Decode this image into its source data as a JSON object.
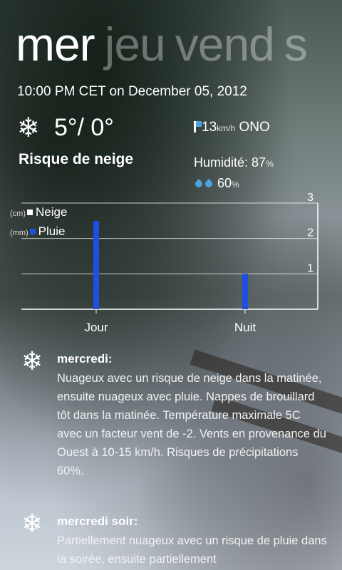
{
  "pivot": {
    "days": [
      "mer",
      "jeu",
      "vend",
      "s"
    ],
    "active_index": 0
  },
  "current": {
    "timestamp": "10:00 PM CET on December 05, 2012",
    "icon": "snowflake-icon",
    "temperature": "5°/ 0°",
    "condition": "Risque de neige",
    "wind_speed": "13",
    "wind_unit": "km/h",
    "wind_direction": "ONO",
    "humidity_label": "Humidité:",
    "humidity_value": "87",
    "precip_value": "60",
    "percent": "%"
  },
  "chart_data": {
    "type": "bar",
    "categories": [
      "Jour",
      "Nuit"
    ],
    "series": [
      {
        "name": "Neige",
        "unit": "(cm)",
        "color": "#ffffff",
        "values": [
          0,
          0
        ]
      },
      {
        "name": "Pluie",
        "unit": "(mm)",
        "color": "#1f4fe0",
        "values": [
          2.5,
          1
        ]
      }
    ],
    "ylim": [
      0,
      3
    ],
    "yticks": [
      "1",
      "2",
      "3"
    ],
    "grid": true,
    "legend_position": "top-left"
  },
  "forecast": [
    {
      "icon": "snowflake-icon",
      "title": "mercredi:",
      "text": "Nuageux avec un risque de neige dans la matinée, ensuite nuageux avec pluie. Nappes de brouillard tôt dans la matinée. Température maximale 5C avec un facteur vent de -2. Vents en provenance du Ouest à 10-15 km/h. Risques de précipitations 60%."
    },
    {
      "icon": "snowflake-icon",
      "title": "mercredi soir:",
      "text": "Partiellement nuageux avec un risque de pluie dans la soirée, ensuite partiellement"
    }
  ],
  "colors": {
    "accent": "#1f4fe0",
    "icon_blue": "#4aa3df"
  }
}
